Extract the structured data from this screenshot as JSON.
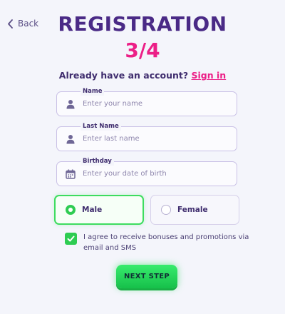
{
  "nav": {
    "back_label": "Back"
  },
  "header": {
    "title": "REGISTRATION",
    "step": "3/4"
  },
  "login": {
    "prompt": "Already have an account?",
    "link": "Sign in"
  },
  "fields": {
    "name": {
      "label": "Name",
      "placeholder": "Enter your name",
      "value": ""
    },
    "last_name": {
      "label": "Last Name",
      "placeholder": "Enter last name",
      "value": ""
    },
    "birthday": {
      "label": "Birthday",
      "placeholder": "Enter your date of birth",
      "value": ""
    }
  },
  "gender": {
    "options": [
      {
        "label": "Male",
        "selected": true
      },
      {
        "label": "Female",
        "selected": false
      }
    ]
  },
  "agreement": {
    "checked": true,
    "text": "I agree to receive bonuses and promotions via email and SMS"
  },
  "actions": {
    "next_label": "NEXT STEP"
  },
  "colors": {
    "primary": "#4a2a86",
    "accent": "#ec1f87",
    "success": "#2ecc52",
    "background": "#f4f5fb"
  }
}
